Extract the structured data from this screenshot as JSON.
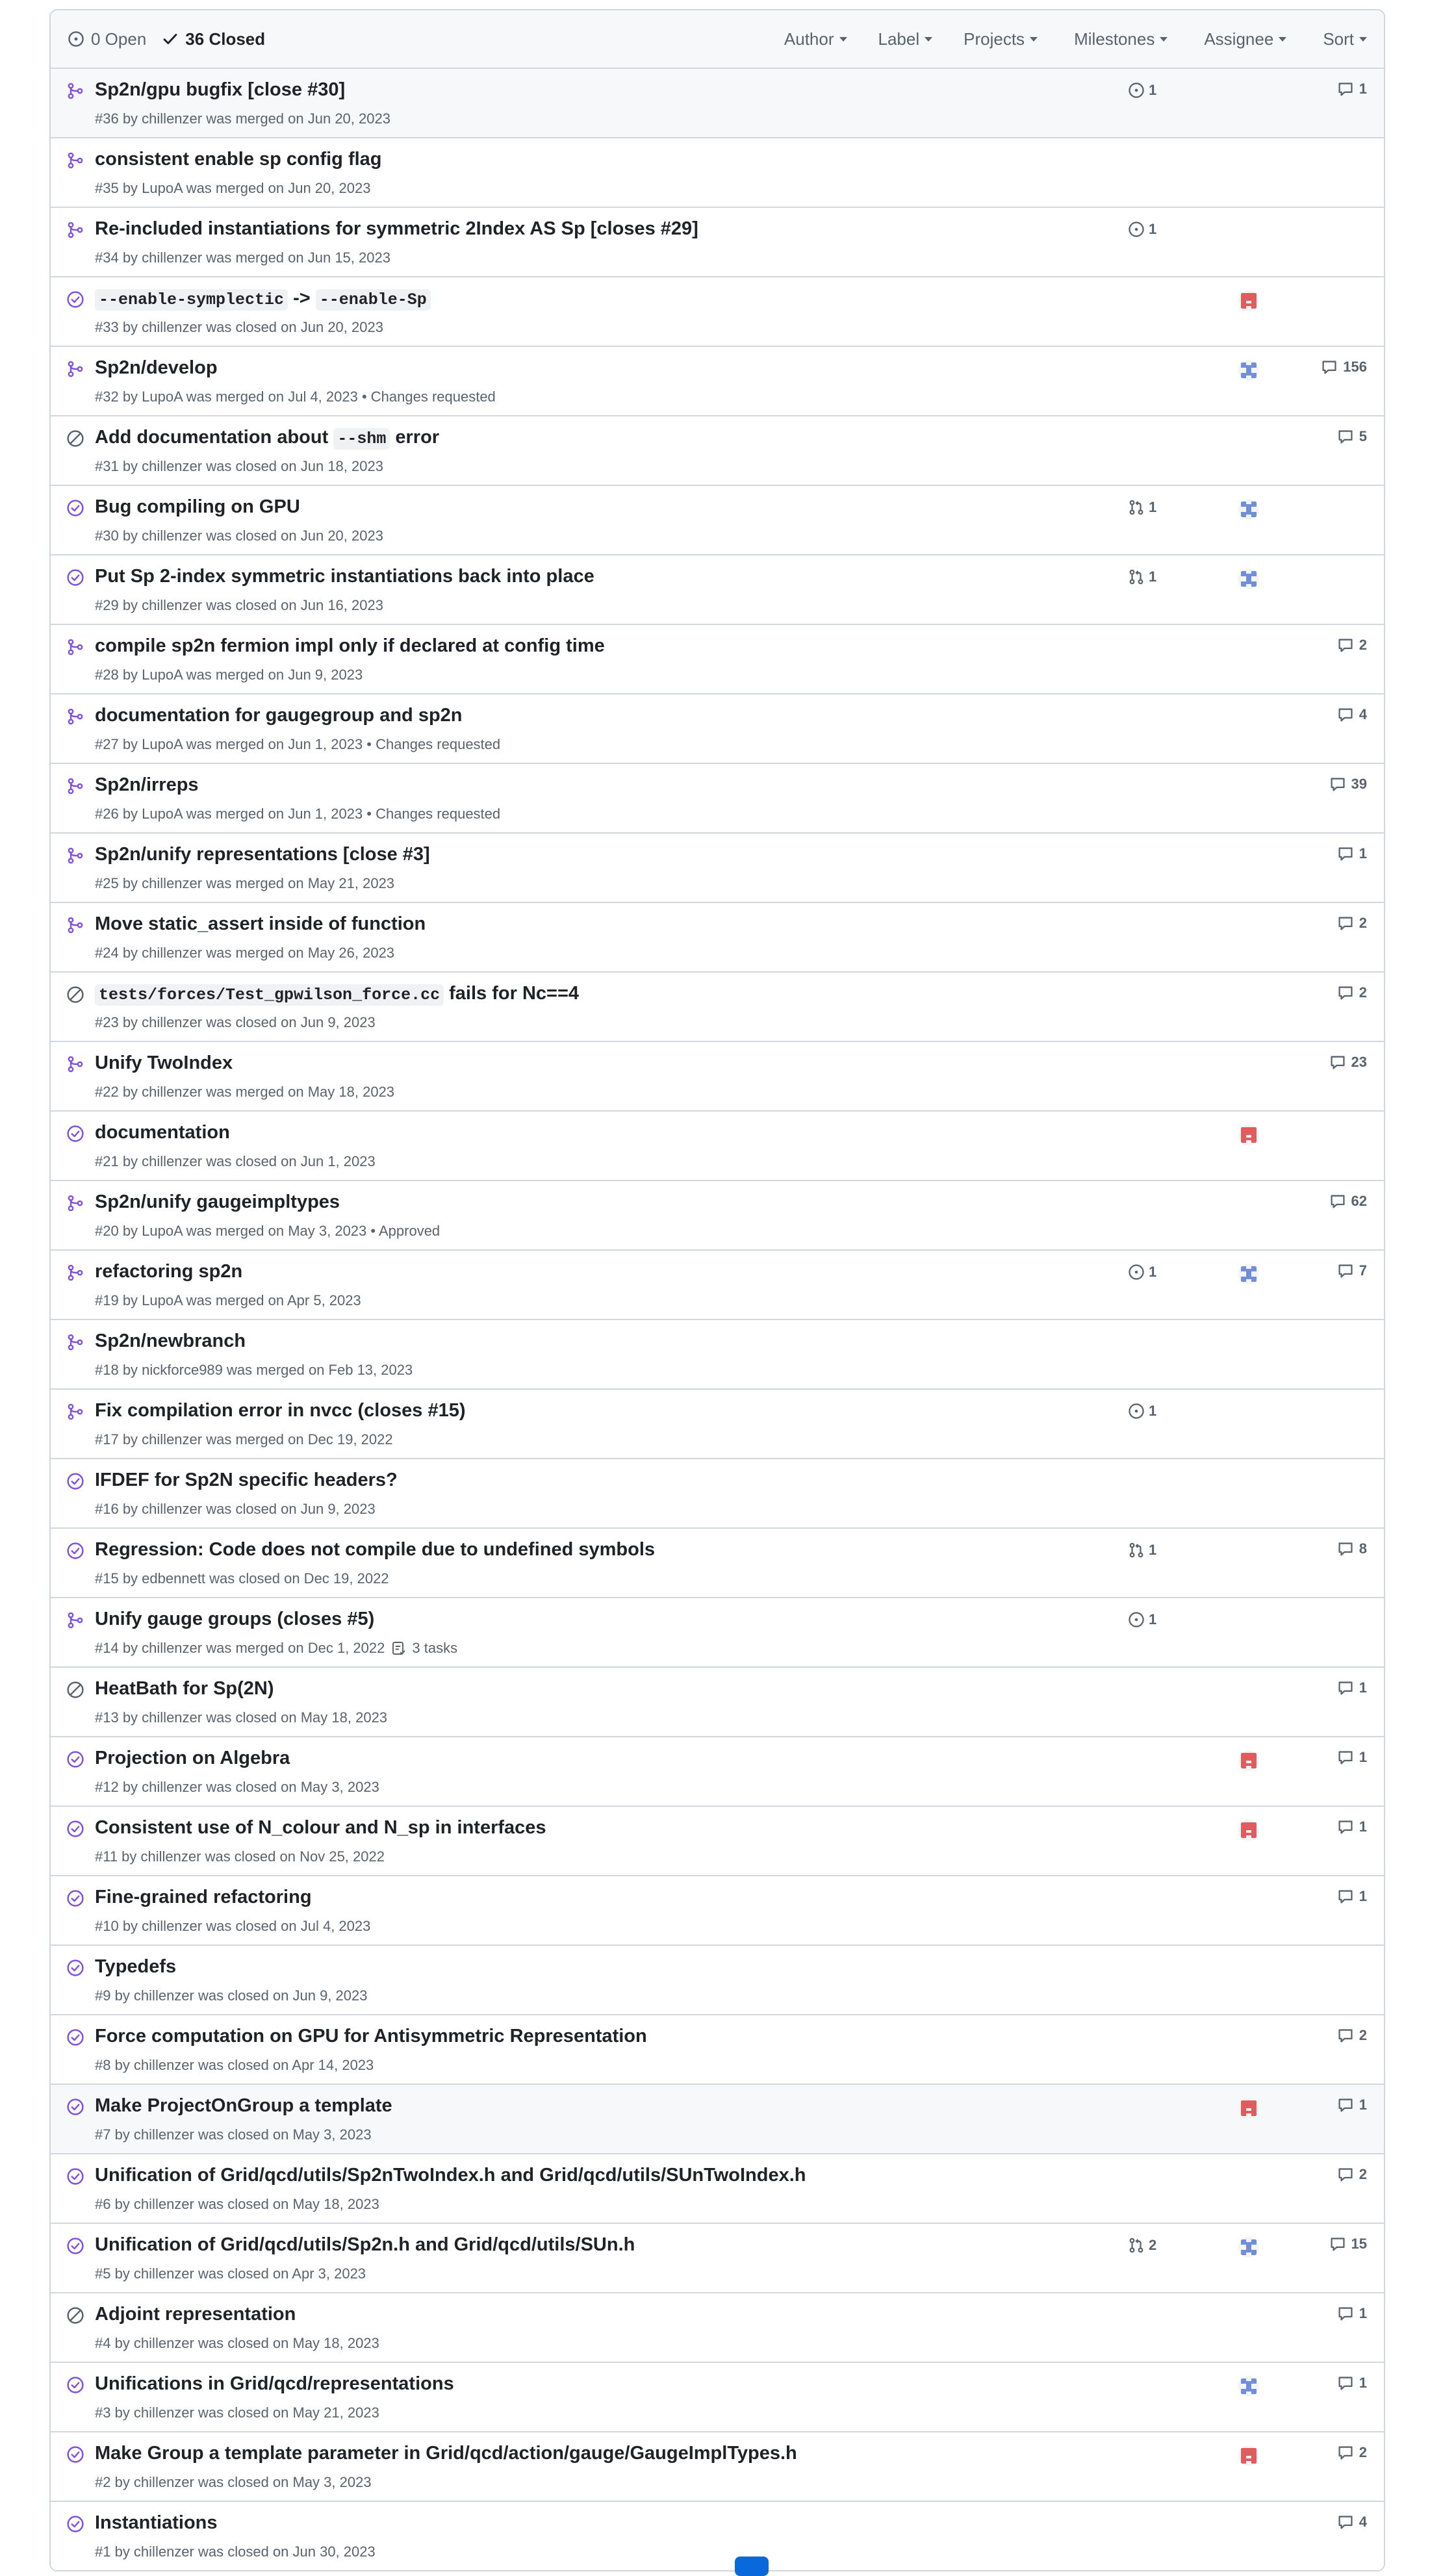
{
  "header": {
    "open_label": "0 Open",
    "closed_label": "36 Closed",
    "filters": [
      "Author",
      "Label",
      "Projects",
      "Milestones",
      "Assignee",
      "Sort"
    ]
  },
  "colors": {
    "merged": "#8250df",
    "closed_done": "#8250df",
    "closed_not_planned": "#59636e",
    "muted": "#59636e",
    "border": "#d0d7de",
    "avatar_red": "#e05d5d",
    "avatar_blue": "#6f8fd8",
    "accent": "#0969da"
  },
  "icons": {
    "open_state": "circle-dot-icon",
    "closed_state": "check-icon",
    "merged": "git-merge-icon",
    "closed_done": "check-circle-icon",
    "closed_not_planned": "skip-icon",
    "linked_issue": "issue-opened-icon",
    "linked_pr": "git-pull-request-icon",
    "comment": "comment-icon",
    "tasks": "tasklist-icon"
  },
  "rows": [
    {
      "title": "Sp2n/gpu bugfix [close #30]",
      "meta": "#36 by chillenzer was merged on Jun 20, 2023",
      "state": "merged",
      "linked": {
        "type": "issue",
        "count": "1"
      },
      "avatar": "",
      "comments": "1",
      "highlight": true
    },
    {
      "title": "consistent enable sp config flag",
      "meta": "#35 by LupoA was merged on Jun 20, 2023",
      "state": "merged",
      "linked": null,
      "avatar": "",
      "comments": ""
    },
    {
      "title": "Re-included instantiations for symmetric 2Index AS Sp [closes #29]",
      "meta": "#34 by chillenzer was merged on Jun 15, 2023",
      "state": "merged",
      "linked": {
        "type": "issue",
        "count": "1"
      },
      "avatar": "",
      "comments": ""
    },
    {
      "title_parts": [
        {
          "code": "--enable-symplectic"
        },
        {
          "text": " -> "
        },
        {
          "code": "--enable-Sp"
        }
      ],
      "meta": "#33 by chillenzer was closed on Jun 20, 2023",
      "state": "closed_done",
      "linked": null,
      "avatar": "red",
      "comments": ""
    },
    {
      "title": "Sp2n/develop",
      "meta": "#32 by LupoA was merged on Jul 4, 2023 • Changes requested",
      "state": "merged",
      "linked": null,
      "avatar": "blue",
      "comments": "156"
    },
    {
      "title_parts": [
        {
          "text": "Add documentation about "
        },
        {
          "code": "--shm"
        },
        {
          "text": " error"
        }
      ],
      "meta": "#31 by chillenzer was closed on Jun 18, 2023",
      "state": "closed_not_planned",
      "linked": null,
      "avatar": "",
      "comments": "5"
    },
    {
      "title": "Bug compiling on GPU",
      "meta": "#30 by chillenzer was closed on Jun 20, 2023",
      "state": "closed_done",
      "linked": {
        "type": "pr",
        "count": "1"
      },
      "avatar": "blue",
      "comments": ""
    },
    {
      "title": "Put Sp 2-index symmetric instantiations back into place",
      "meta": "#29 by chillenzer was closed on Jun 16, 2023",
      "state": "closed_done",
      "linked": {
        "type": "pr",
        "count": "1"
      },
      "avatar": "blue",
      "comments": ""
    },
    {
      "title": "compile sp2n fermion impl only if declared at config time",
      "meta": "#28 by LupoA was merged on Jun 9, 2023",
      "state": "merged",
      "linked": null,
      "avatar": "",
      "comments": "2"
    },
    {
      "title": "documentation for gaugegroup and sp2n",
      "meta": "#27 by LupoA was merged on Jun 1, 2023 • Changes requested",
      "state": "merged",
      "linked": null,
      "avatar": "",
      "comments": "4"
    },
    {
      "title": "Sp2n/irreps",
      "meta": "#26 by LupoA was merged on Jun 1, 2023 • Changes requested",
      "state": "merged",
      "linked": null,
      "avatar": "",
      "comments": "39"
    },
    {
      "title": "Sp2n/unify representations [close #3]",
      "meta": "#25 by chillenzer was merged on May 21, 2023",
      "state": "merged",
      "linked": null,
      "avatar": "",
      "comments": "1"
    },
    {
      "title": "Move static_assert inside of function",
      "meta": "#24 by chillenzer was merged on May 26, 2023",
      "state": "merged",
      "linked": null,
      "avatar": "",
      "comments": "2"
    },
    {
      "title_parts": [
        {
          "code": "tests/forces/Test_gpwilson_force.cc"
        },
        {
          "text": " fails for Nc==4"
        }
      ],
      "meta": "#23 by chillenzer was closed on Jun 9, 2023",
      "state": "closed_not_planned",
      "linked": null,
      "avatar": "",
      "comments": "2"
    },
    {
      "title": "Unify TwoIndex",
      "meta": "#22 by chillenzer was merged on May 18, 2023",
      "state": "merged",
      "linked": null,
      "avatar": "",
      "comments": "23"
    },
    {
      "title": "documentation",
      "meta": "#21 by chillenzer was closed on Jun 1, 2023",
      "state": "closed_done",
      "linked": null,
      "avatar": "red",
      "comments": ""
    },
    {
      "title": "Sp2n/unify gaugeimpltypes",
      "meta": "#20 by LupoA was merged on May 3, 2023 • Approved",
      "state": "merged",
      "linked": null,
      "avatar": "",
      "comments": "62"
    },
    {
      "title": "refactoring sp2n",
      "meta": "#19 by LupoA was merged on Apr 5, 2023",
      "state": "merged",
      "linked": {
        "type": "issue",
        "count": "1"
      },
      "avatar": "blue",
      "comments": "7"
    },
    {
      "title": "Sp2n/newbranch",
      "meta": "#18 by nickforce989 was merged on Feb 13, 2023",
      "state": "merged",
      "linked": null,
      "avatar": "",
      "comments": ""
    },
    {
      "title": "Fix compilation error in nvcc (closes #15)",
      "meta": "#17 by chillenzer was merged on Dec 19, 2022",
      "state": "merged",
      "linked": {
        "type": "issue",
        "count": "1"
      },
      "avatar": "",
      "comments": ""
    },
    {
      "title": "IFDEF for Sp2N specific headers?",
      "meta": "#16 by chillenzer was closed on Jun 9, 2023",
      "state": "closed_done",
      "linked": null,
      "avatar": "",
      "comments": ""
    },
    {
      "title": "Regression: Code does not compile due to undefined symbols",
      "meta": "#15 by edbennett was closed on Dec 19, 2022",
      "state": "closed_done",
      "linked": {
        "type": "pr",
        "count": "1"
      },
      "avatar": "",
      "comments": "8"
    },
    {
      "title": "Unify gauge groups (closes #5)",
      "meta": "#14 by chillenzer was merged on Dec 1, 2022",
      "tasks": "3 tasks",
      "state": "merged",
      "linked": {
        "type": "issue",
        "count": "1"
      },
      "avatar": "",
      "comments": ""
    },
    {
      "title": "HeatBath for Sp(2N)",
      "meta": "#13 by chillenzer was closed on May 18, 2023",
      "state": "closed_not_planned",
      "linked": null,
      "avatar": "",
      "comments": "1"
    },
    {
      "title": "Projection on Algebra",
      "meta": "#12 by chillenzer was closed on May 3, 2023",
      "state": "closed_done",
      "linked": null,
      "avatar": "red",
      "comments": "1"
    },
    {
      "title": "Consistent use of N_colour and N_sp in interfaces",
      "meta": "#11 by chillenzer was closed on Nov 25, 2022",
      "state": "closed_done",
      "linked": null,
      "avatar": "red",
      "comments": "1"
    },
    {
      "title": "Fine-grained refactoring",
      "meta": "#10 by chillenzer was closed on Jul 4, 2023",
      "state": "closed_done",
      "linked": null,
      "avatar": "",
      "comments": "1"
    },
    {
      "title": "Typedefs",
      "meta": "#9 by chillenzer was closed on Jun 9, 2023",
      "state": "closed_done",
      "linked": null,
      "avatar": "",
      "comments": ""
    },
    {
      "title": "Force computation on GPU for Antisymmetric Representation",
      "meta": "#8 by chillenzer was closed on Apr 14, 2023",
      "state": "closed_done",
      "linked": null,
      "avatar": "",
      "comments": "2"
    },
    {
      "title": "Make ProjectOnGroup a template",
      "meta": "#7 by chillenzer was closed on May 3, 2023",
      "state": "closed_done",
      "linked": null,
      "avatar": "red",
      "comments": "1",
      "highlight": true
    },
    {
      "title": "Unification of Grid/qcd/utils/Sp2nTwoIndex.h and Grid/qcd/utils/SUnTwoIndex.h",
      "meta": "#6 by chillenzer was closed on May 18, 2023",
      "state": "closed_done",
      "linked": null,
      "avatar": "",
      "comments": "2"
    },
    {
      "title": "Unification of Grid/qcd/utils/Sp2n.h and Grid/qcd/utils/SUn.h",
      "meta": "#5 by chillenzer was closed on Apr 3, 2023",
      "state": "closed_done",
      "linked": {
        "type": "pr",
        "count": "2"
      },
      "avatar": "blue",
      "comments": "15"
    },
    {
      "title": "Adjoint representation",
      "meta": "#4 by chillenzer was closed on May 18, 2023",
      "state": "closed_not_planned",
      "linked": null,
      "avatar": "",
      "comments": "1"
    },
    {
      "title": "Unifications in Grid/qcd/representations",
      "meta": "#3 by chillenzer was closed on May 21, 2023",
      "state": "closed_done",
      "linked": null,
      "avatar": "blue",
      "comments": "1"
    },
    {
      "title": "Make Group a template parameter in Grid/qcd/action/gauge/GaugeImplTypes.h",
      "meta": "#2 by chillenzer was closed on May 3, 2023",
      "state": "closed_done",
      "linked": null,
      "avatar": "red",
      "comments": "2"
    },
    {
      "title": "Instantiations",
      "meta": "#1 by chillenzer was closed on Jun 30, 2023",
      "state": "closed_done",
      "linked": null,
      "avatar": "",
      "comments": "4"
    }
  ]
}
